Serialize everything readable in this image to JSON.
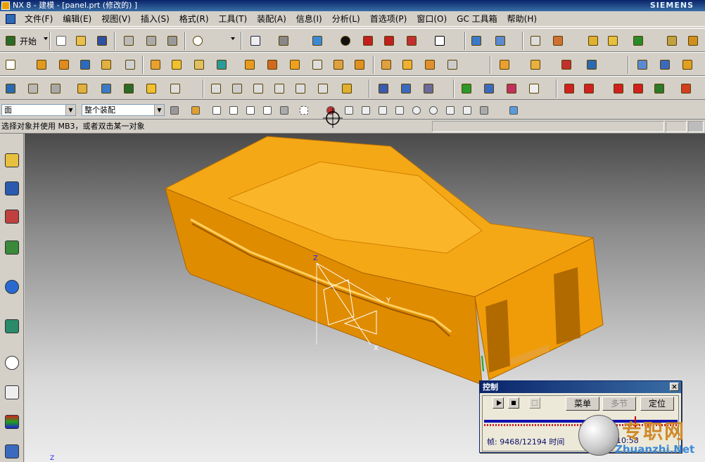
{
  "window": {
    "title": "NX 8 - 建模 - [panel.prt (修改的) ]",
    "brand": "SIEMENS"
  },
  "menu": [
    "文件(F)",
    "编辑(E)",
    "视图(V)",
    "插入(S)",
    "格式(R)",
    "工具(T)",
    "装配(A)",
    "信息(I)",
    "分析(L)",
    "首选项(P)",
    "窗口(O)",
    "GC 工具箱",
    "帮助(H)"
  ],
  "toolbar": {
    "start_label": "开始"
  },
  "selection_bar": {
    "type_filter": "面",
    "scope": "整个装配"
  },
  "status": {
    "prompt": "选择对象并使用 MB3，或者双击某一对象"
  },
  "triad_labels": {
    "z": "Z",
    "y": "Y",
    "x": "X"
  },
  "wcs_label": "Z",
  "control_dialog": {
    "title": "控制",
    "close_label": "×",
    "buttons": {
      "menu": "菜单",
      "multi_step": "多节",
      "position": "定位"
    },
    "progress_fraction": 0.777,
    "frame_text": "帧: 9468/12194 时间",
    "time_text": "10:58"
  },
  "watermark": {
    "line1": "专职网",
    "line2": "Zhuanzhi.Net"
  },
  "colors": {
    "part": "#f0a010",
    "part_dark": "#c87a00",
    "title_bg": "#0a246a"
  }
}
